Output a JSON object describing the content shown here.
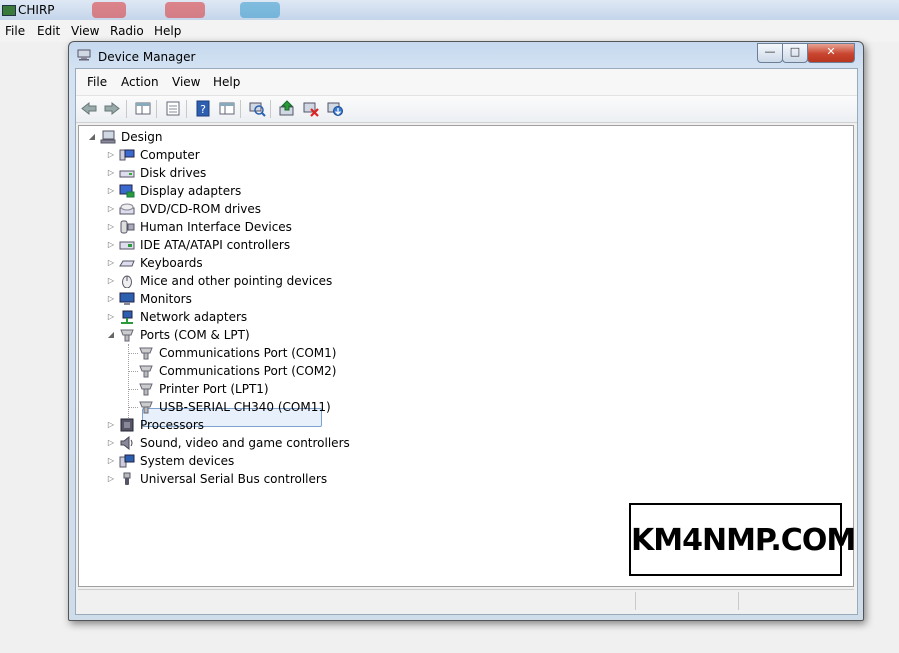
{
  "chirp": {
    "title": "CHIRP",
    "menu": [
      "File",
      "Edit",
      "View",
      "Radio",
      "Help"
    ]
  },
  "device_manager": {
    "title": "Device Manager",
    "menu": [
      "File",
      "Action",
      "View",
      "Help"
    ],
    "toolbar_icons": [
      "back-icon",
      "forward-icon",
      "properties-grid-icon",
      "document-icon",
      "help-icon",
      "console-tree-icon",
      "scan-hardware-icon",
      "update-driver-icon",
      "disable-device-icon",
      "uninstall-device-icon"
    ],
    "tree": {
      "root": "Design",
      "categories": [
        {
          "label": "Computer",
          "icon": "computer-icon"
        },
        {
          "label": "Disk drives",
          "icon": "disk-drive-icon"
        },
        {
          "label": "Display adapters",
          "icon": "display-adapter-icon"
        },
        {
          "label": "DVD/CD-ROM drives",
          "icon": "dvd-drive-icon"
        },
        {
          "label": "Human Interface Devices",
          "icon": "hid-icon"
        },
        {
          "label": "IDE ATA/ATAPI controllers",
          "icon": "ide-controller-icon"
        },
        {
          "label": "Keyboards",
          "icon": "keyboard-icon"
        },
        {
          "label": "Mice and other pointing devices",
          "icon": "mouse-icon"
        },
        {
          "label": "Monitors",
          "icon": "monitor-icon"
        },
        {
          "label": "Network adapters",
          "icon": "network-adapter-icon"
        },
        {
          "label": "Ports (COM & LPT)",
          "icon": "port-icon"
        },
        {
          "label": "Processors",
          "icon": "processor-icon"
        },
        {
          "label": "Sound, video and game controllers",
          "icon": "sound-icon"
        },
        {
          "label": "System devices",
          "icon": "system-devices-icon"
        },
        {
          "label": "Universal Serial Bus controllers",
          "icon": "usb-icon"
        }
      ],
      "ports_children": [
        "Communications Port (COM1)",
        "Communications Port (COM2)",
        "Printer Port (LPT1)",
        "USB-SERIAL CH340 (COM11)"
      ],
      "selected": "USB-SERIAL CH340 (COM11)"
    }
  },
  "watermark": "KM4NMP.COM"
}
